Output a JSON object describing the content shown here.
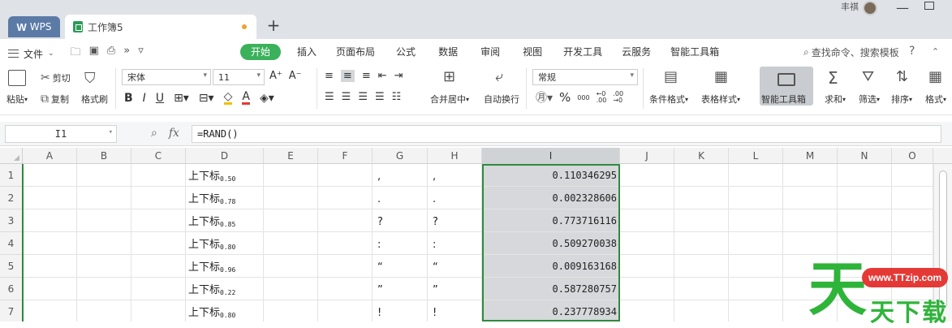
{
  "titlebar": {
    "wps_tab": "WPS",
    "doc_tab": "工作簿5",
    "new_tab": "+",
    "user_name": "丰祺"
  },
  "menubar": {
    "file": "文件",
    "tabs": [
      "开始",
      "插入",
      "页面布局",
      "公式",
      "数据",
      "审阅",
      "视图",
      "开发工具",
      "云服务",
      "智能工具箱"
    ],
    "search": "查找命令、搜索模板",
    "help": "?"
  },
  "ribbon": {
    "paste": "粘贴",
    "cut": "剪切",
    "copy": "复制",
    "format_painter": "格式刷",
    "font_name": "宋体",
    "font_size": "11",
    "merge_center": "合并居中",
    "wrap_text": "自动换行",
    "number_format": "常规",
    "percent": "%",
    "thousands": "000",
    "cond_format": "条件格式",
    "table_style": "表格样式",
    "smart_toolbox": "智能工具箱",
    "sum": "求和",
    "filter": "筛选",
    "sort": "排序",
    "format": "格式"
  },
  "formula_bar": {
    "name_box": "I1",
    "fx": "fx",
    "formula": "=RAND()"
  },
  "sheet": {
    "columns": [
      "A",
      "B",
      "C",
      "D",
      "E",
      "F",
      "G",
      "H",
      "I",
      "J",
      "K",
      "L",
      "M",
      "N",
      "O"
    ],
    "selected_column": "I",
    "rows": [
      {
        "n": "1",
        "d": "上下标",
        "d_sup": "0.50",
        "g": ",",
        "h": ",",
        "i": "0.110346295"
      },
      {
        "n": "2",
        "d": "上下标",
        "d_sup": "0.78",
        "g": ".",
        "h": ".",
        "i": "0.002328606"
      },
      {
        "n": "3",
        "d": "上下标",
        "d_sup": "0.85",
        "g": "?",
        "h": "?",
        "i": "0.773716116"
      },
      {
        "n": "4",
        "d": "上下标",
        "d_sup": "0.80",
        "g": ":",
        "h": ":",
        "i": "0.509270038"
      },
      {
        "n": "5",
        "d": "上下标",
        "d_sup": "0.96",
        "g": "“",
        "h": "“",
        "i": "0.009163168"
      },
      {
        "n": "6",
        "d": "上下标",
        "d_sup": "0.22",
        "g": "”",
        "h": "”",
        "i": "0.587280757"
      },
      {
        "n": "7",
        "d": "上下标",
        "d_sup": "0.80",
        "g": "!",
        "h": "!",
        "i": "0.237778934"
      }
    ]
  },
  "watermark": {
    "big": "天",
    "badge": "www.TTzip.com",
    "sub": "天下载"
  },
  "colors": {
    "accent_green": "#3bb15b",
    "selection_border": "#2f8a3f",
    "wps_tab": "#5b7aa6"
  }
}
